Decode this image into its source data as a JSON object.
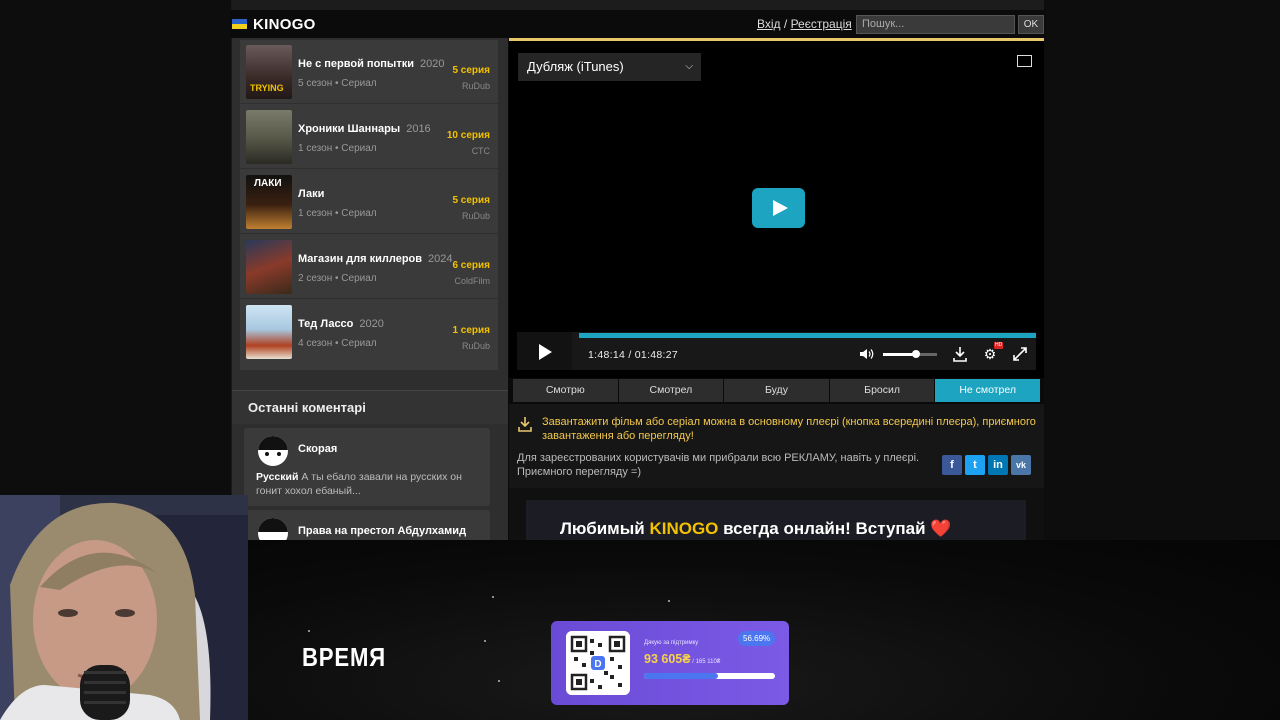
{
  "header": {
    "logo": "KINOGO",
    "login": "Вхід",
    "separator": "/",
    "register": "Реєстрація",
    "search_placeholder": "Пошук...",
    "search_button": "OK"
  },
  "new_episodes": [
    {
      "title": "Не с первой попытки",
      "year": "2020",
      "meta": "5 сезон • Сериал",
      "episode": "5 серия",
      "source": "RuDub",
      "thumb_color": "#3a2a28"
    },
    {
      "title": "Хроники Шаннары",
      "year": "2016",
      "meta": "1 сезон • Сериал",
      "episode": "10 серия",
      "source": "СТС",
      "thumb_color": "#5a5a4a"
    },
    {
      "title": "Лаки",
      "year": "",
      "meta": "1 сезон • Сериал",
      "episode": "5 серия",
      "source": "RuDub",
      "thumb_color": "#2a1a10"
    },
    {
      "title": "Магазин для киллеров",
      "year": "2024",
      "meta": "2 сезон • Сериал",
      "episode": "6 серия",
      "source": "ColdFilm",
      "thumb_color": "#6a2a22"
    },
    {
      "title": "Тед Лассо",
      "year": "2020",
      "meta": "4 сезон • Сериал",
      "episode": "1 серия",
      "source": "RuDub",
      "thumb_color": "#a8c8e0"
    }
  ],
  "thumb_text": [
    "TRYING",
    "",
    "ЛАКИ",
    "",
    ""
  ],
  "comments_section": {
    "title": "Останні коментарі",
    "items": [
      {
        "author": "Скорая",
        "film": "Русский",
        "text": " А ты ебало завали на русских он гонит хохол ебаный..."
      },
      {
        "author": "Права на престол Абдулхамид",
        "film": "",
        "text": ""
      }
    ]
  },
  "player": {
    "dub_select": "Дубляж (iTunes)",
    "time": "1:48:14 / 01:48:27",
    "progress": 1.0,
    "volume": 0.6,
    "hd_badge": "HD"
  },
  "status_tabs": [
    "Смотрю",
    "Смотрел",
    "Буду",
    "Бросил",
    "Не смотрел"
  ],
  "active_tab": "Не смотрел",
  "info": {
    "download_note": "Завантажити фільм або серіал можна в основному плеєрі (кнопка всередині плеєра), приємного завантаження або перегляду!",
    "registered_note": "Для зареєстрованих користувачів ми прибрали всю РЕКЛАМУ, навіть у плеєрі. Приємного перегляду =)",
    "share_icons": [
      "f",
      "t",
      "in",
      "vk"
    ]
  },
  "banner": {
    "text_before": "Любимый ",
    "highlight": "KINOGO",
    "text_after": " всегда онлайн! Вступай ❤️"
  },
  "stream": {
    "caption": "ВРЕМЯ",
    "donation": {
      "label": "Дякую за підтримку",
      "amount": "93 605₴",
      "goal": " / 165 110₴",
      "percent": "56.69%",
      "fraction": 0.567
    }
  },
  "colors": {
    "accent": "#1ca4c0",
    "episode": "#f2c200",
    "gold_border": "#e9c76b",
    "donation_bg": "#7b5ae6"
  }
}
